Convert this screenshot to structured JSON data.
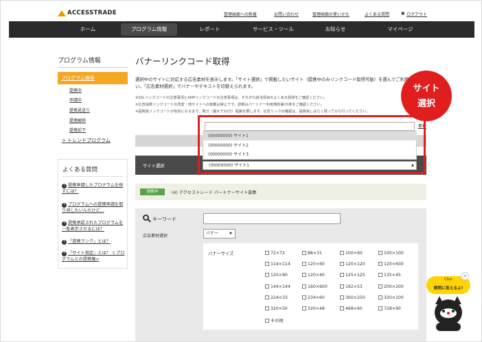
{
  "header": {
    "logo_text": "ACCESSTRADE",
    "links": [
      "管理画面への新着",
      "お問い合わせ",
      "管理画面の使いかた",
      "よくある質問",
      "ログアウト"
    ]
  },
  "nav": {
    "items": [
      "ホーム",
      "プログラム情報",
      "レポート",
      "サービス・ツール",
      "お知らせ",
      "マイページ"
    ],
    "active": "プログラム情報"
  },
  "sidebar": {
    "title": "プログラム情報",
    "active_item": "プログラム検索",
    "sub_items": [
      "提携中",
      "申請中",
      "提携見送り",
      "提携解除",
      "提携却下"
    ],
    "trend_item": "トレンドプログラム",
    "faq_title": "よくある質問",
    "faq_items": [
      "提携申請したプログラムを探すには？",
      "プログラムへの提携申請を取り消したいんだけど...",
      "提携承認されたプログラムを一覧表示させるには？",
      "「提携ランク」とは？",
      "「サイト指定」とは？ くプログラムとの提携権>"
    ]
  },
  "main": {
    "title": "バナーリンクコード取得",
    "description": "選択中のサイトに対応する広告素材を表示します。「サイト選択」で掲載したいサイト（提携中のみリンクコード取得可能）を選んでご利用ください。「広告素材選択」でバナーやテキストを切替えられます。",
    "notes": [
      "※SSLリンクコードの注意事項とAMPリンクコードの注意事項は、それぞれ該当項目のよくある質問をご確認ください。",
      "※広告提携リンクコードの改変・他サイトへの転載は禁止です。詳細はパートナー利用規約第15条をご確認ください。",
      "※提携後リンクコードが有効になるまで、数分（最大で10分）程度を要します。広告リンクの確認は、提携後しばらく経ってから行ってください。"
    ],
    "kenzai_button": "素材",
    "site_select_label": "サイト選択",
    "site_dropdown": {
      "search_value": "",
      "options": [
        "(00000000) サイト1",
        "(00000000) サイト2",
        "(00000000) サイト3"
      ],
      "highlighted_index": 0,
      "selected": "(00000000) サイト1"
    },
    "callout": [
      "サイト",
      "選択"
    ],
    "status_badge": "提携中",
    "status_text": "(4) アクセストレード パートナーサイト募集",
    "search": {
      "keyword_label": "キーワード",
      "keyword_value": "",
      "type_label": "広告素材選択",
      "type_value": "バナー",
      "size_label": "バナーサイズ",
      "sizes": [
        "72×72",
        "88×31",
        "100×60",
        "100×100",
        "114×114",
        "120×60",
        "120×120",
        "120×600",
        "120×90",
        "120×40",
        "125×125",
        "135×45",
        "144×144",
        "160×600",
        "192×53",
        "200×200",
        "224×33",
        "234×60",
        "300×250",
        "320×100",
        "320×50",
        "320×48",
        "468×60",
        "728×90",
        "その他"
      ]
    }
  },
  "helper": {
    "line1": "Click",
    "line2": "質問に答えるよ!"
  },
  "colors": {
    "accent": "#f5a623",
    "nav_bg": "#2b2b2b",
    "callout_red": "#e01e1e",
    "status_green": "#5aa34a"
  }
}
